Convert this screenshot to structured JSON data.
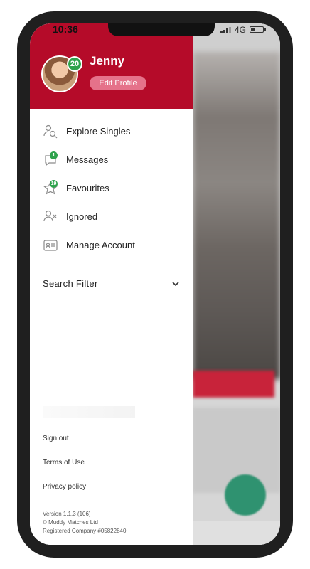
{
  "status_bar": {
    "time": "10:36",
    "network": "4G"
  },
  "profile": {
    "name": "Jenny",
    "badge_count": "20",
    "edit_label": "Edit Profile"
  },
  "menu": [
    {
      "label": "Explore Singles",
      "icon": "explore-singles-icon",
      "badge": ""
    },
    {
      "label": "Messages",
      "icon": "messages-icon",
      "badge": "1"
    },
    {
      "label": "Favourites",
      "icon": "favourites-icon",
      "badge": "19"
    },
    {
      "label": "Ignored",
      "icon": "ignored-icon",
      "badge": ""
    },
    {
      "label": "Manage Account",
      "icon": "manage-account-icon",
      "badge": ""
    }
  ],
  "search_filter": {
    "label": "Search Filter"
  },
  "footer": {
    "sign_out": "Sign out",
    "terms": "Terms of Use",
    "privacy": "Privacy policy",
    "version": "Version 1.1.3 (106)",
    "copyright": "© Muddy Matches Ltd",
    "registered": "Registered Company #05822840"
  },
  "colors": {
    "header_red": "#b50b29",
    "badge_green": "#2fa34d",
    "edit_pill": "#e5728a"
  }
}
